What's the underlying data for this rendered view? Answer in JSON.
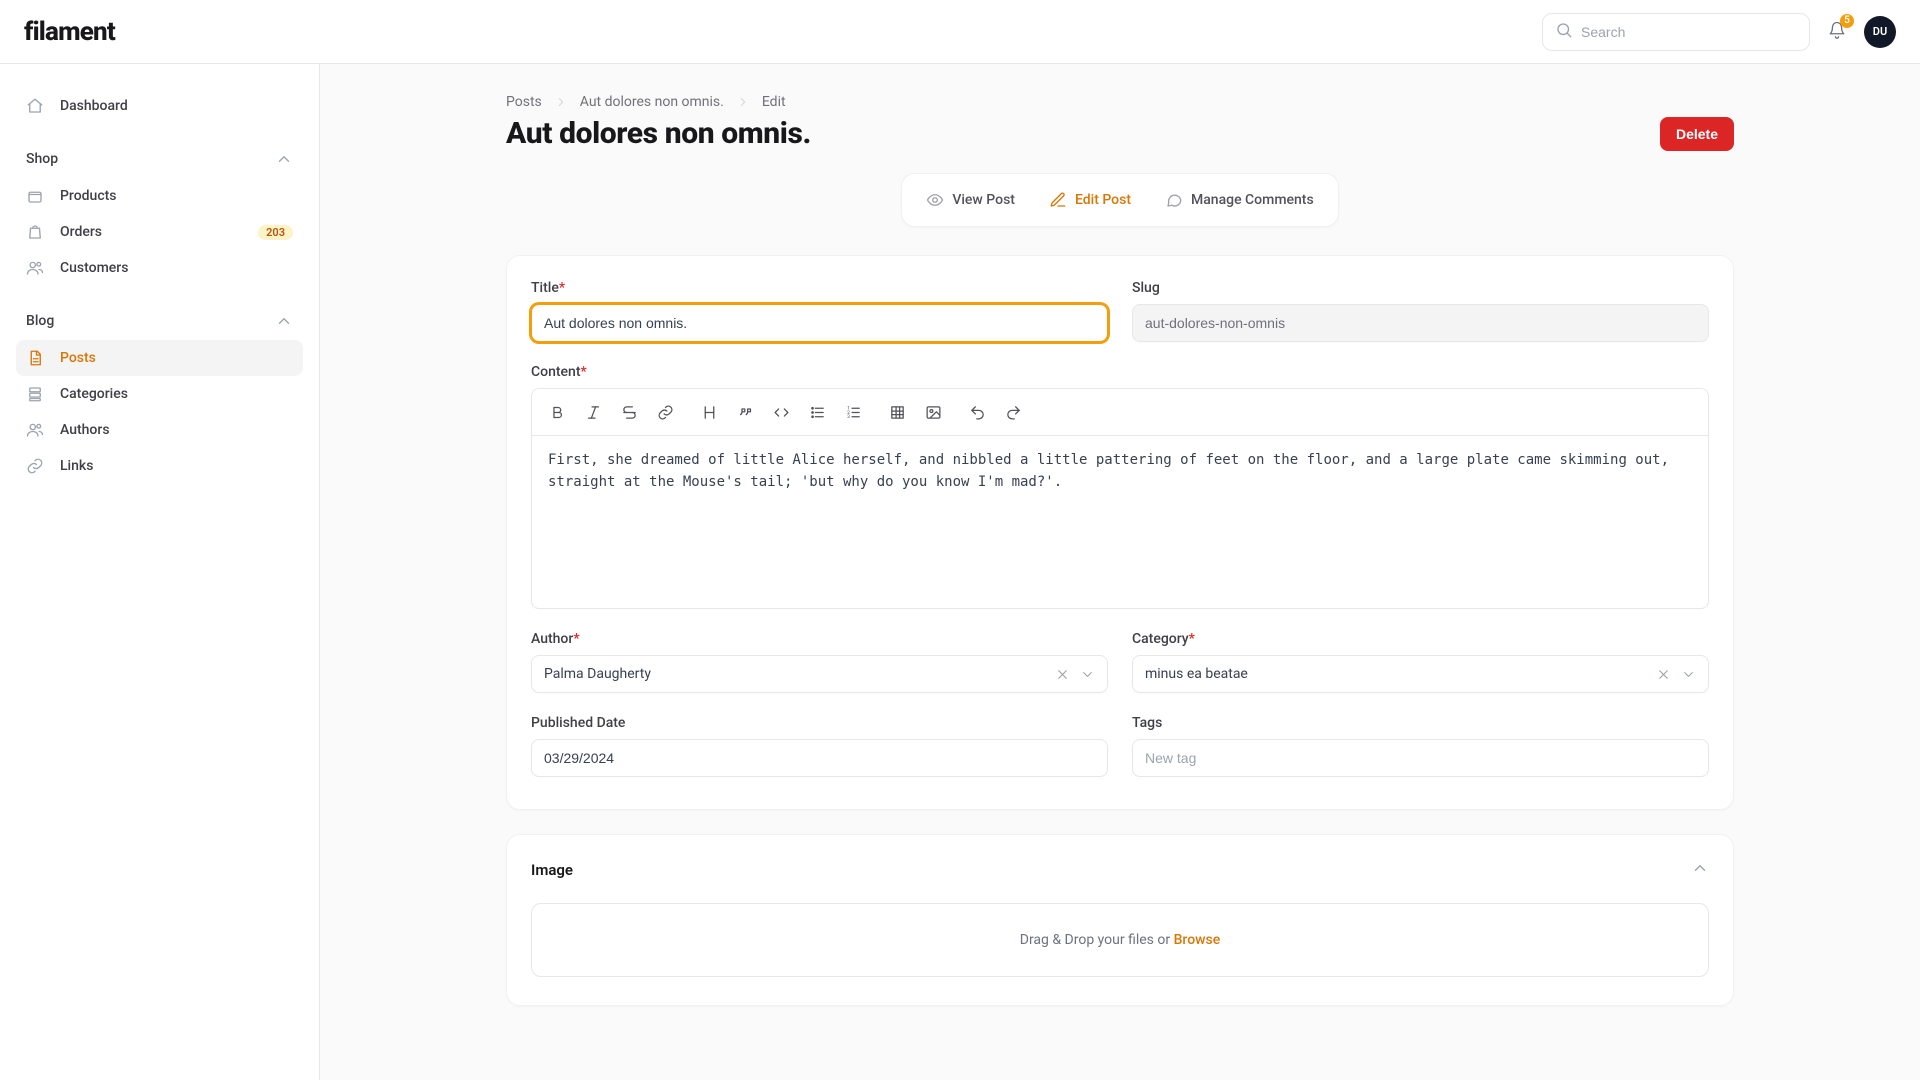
{
  "brand": {
    "name": "filament"
  },
  "search": {
    "placeholder": "Search"
  },
  "notifications": {
    "count": "5"
  },
  "user": {
    "initials": "DU"
  },
  "sidebar": {
    "dashboard": "Dashboard",
    "groups": [
      {
        "label": "Shop",
        "items": [
          {
            "label": "Products"
          },
          {
            "label": "Orders",
            "badge": "203"
          },
          {
            "label": "Customers"
          }
        ]
      },
      {
        "label": "Blog",
        "items": [
          {
            "label": "Posts"
          },
          {
            "label": "Categories"
          },
          {
            "label": "Authors"
          },
          {
            "label": "Links"
          }
        ]
      }
    ]
  },
  "breadcrumbs": {
    "a": "Posts",
    "b": "Aut dolores non omnis.",
    "c": "Edit"
  },
  "page": {
    "title": "Aut dolores non omnis.",
    "delete": "Delete"
  },
  "subnav": {
    "view": "View Post",
    "edit": "Edit Post",
    "comments": "Manage Comments"
  },
  "form": {
    "labels": {
      "title": "Title",
      "slug": "Slug",
      "content": "Content",
      "author": "Author",
      "category": "Category",
      "published": "Published Date",
      "tags": "Tags",
      "tags_placeholder": "New tag",
      "image": "Image"
    },
    "values": {
      "title": "Aut dolores non omnis.",
      "slug": "aut-dolores-non-omnis",
      "content": "First, she dreamed of little Alice herself, and nibbled a little pattering of feet on the floor, and a large plate came skimming out, straight at the Mouse's tail; 'but why do you know I'm mad?'.",
      "author": "Palma Daugherty",
      "category": "minus ea beatae",
      "published": "03/29/2024"
    }
  },
  "dropzone": {
    "text": "Drag & Drop your files or ",
    "browse": "Browse"
  }
}
